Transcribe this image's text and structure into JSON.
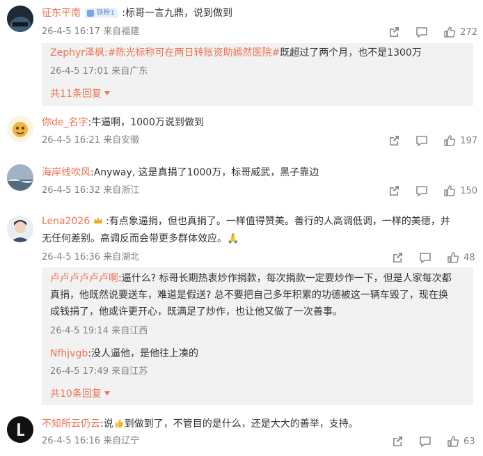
{
  "comments": [
    {
      "username": "征东平南",
      "badge": "铁粉1",
      "text": ":标哥一言九鼎，说到做到",
      "meta": "26-4-5 16:17 来自福建",
      "likes": "272",
      "reply_preview": {
        "username": "Zephyr泽枫",
        "tag": ":#陈光标称可在两日转账资助嫣然医院#",
        "text": "既超过了两个月，也不是1300万",
        "meta": "26-4-5 17:01 来自广东",
        "more": "共11条回复"
      }
    },
    {
      "username": "你de_名字",
      "text": ":牛逼啊，1000万说到做到",
      "meta": "26-4-5 16:21 来自安徽",
      "likes": "197"
    },
    {
      "username": "海岸线吹风",
      "text": ":Anyway, 这是真捐了1000万，标哥威武，黑子靠边",
      "meta": "26-4-5 16:32 来自浙江",
      "likes": "150"
    },
    {
      "username": "Lena2026",
      "text_line1": ":有点象逼捐，但也真捐了。一样值得赞美。善行的人高调低调，一样的美德，并",
      "text_line2": "无任何差别。高调反而会带更多群体效应。🙏",
      "meta": "26-4-5 16:36 来自湖北",
      "likes": "48",
      "replies": [
        {
          "username": "卢卢卢卢卢卢啊",
          "text_line1": ":逼什么? 标哥长期热衷炒作捐款，每次捐款一定要炒作一下，但是人家每次都",
          "text_line2": "真捐，他既然说要送车，难道是假送? 总不要把自己多年积累的功德被这一辆车毁了，现在换",
          "text_line3": "成钱捐了，他或许更开心，既满足了炒作，也让他又做了一次善事。",
          "meta": "26-4-5 19:14 来自江西"
        },
        {
          "username": "Nfhjvgb",
          "text": ":没人逼他，是他往上凑的",
          "meta": "26-4-5 17:49 来自江苏"
        }
      ],
      "more": "共10条回复"
    },
    {
      "username": "不知所云仍云",
      "text_pre": ":说",
      "text_post": "到做到了，不管目的是什么，还是大大的善举，支持。",
      "meta": "26-4-5 16:16 来自辽宁",
      "likes": "63"
    }
  ],
  "icons": [
    "share-icon",
    "comment-icon",
    "like-icon"
  ],
  "colors": {
    "accent": "#eb7350",
    "meta": "#808080",
    "reply_bg": "#f2f2f2"
  }
}
